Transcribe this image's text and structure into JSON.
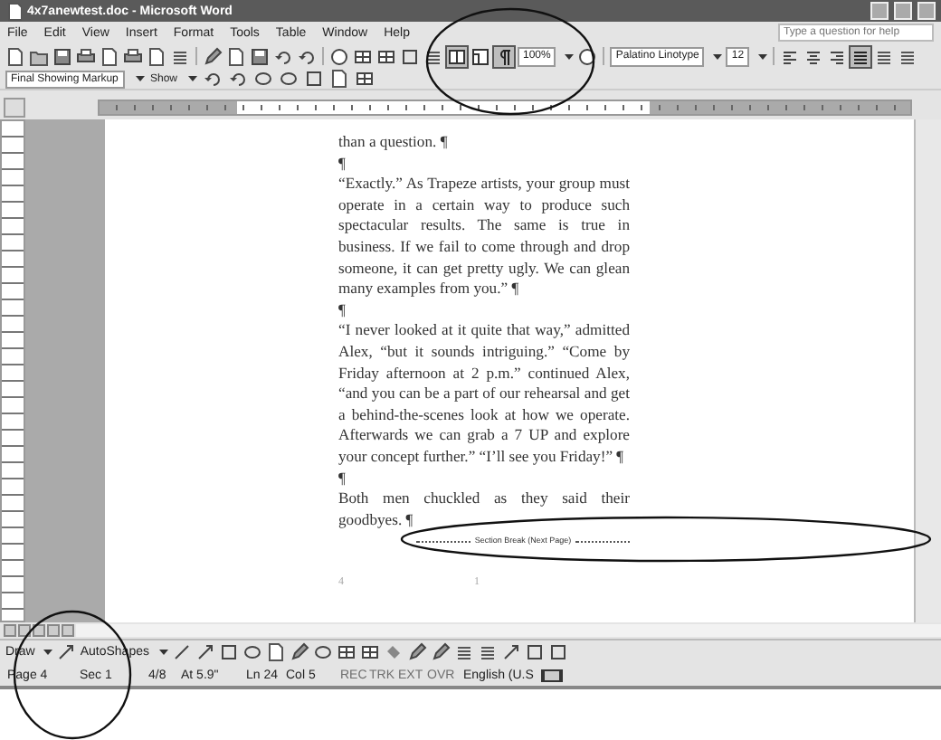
{
  "window": {
    "title": "4x7anewtest.doc - Microsoft Word"
  },
  "menu": [
    "File",
    "Edit",
    "View",
    "Insert",
    "Format",
    "Tools",
    "Table",
    "Window",
    "Help"
  ],
  "help_box": {
    "placeholder": "Type a question for help"
  },
  "standard_toolbar": {
    "toggles": [
      {
        "kind": "reading",
        "selected": true
      },
      {
        "kind": "document-map",
        "selected": false
      },
      {
        "kind": "formatting-marks",
        "selected": true
      }
    ],
    "zoom": "100%"
  },
  "formatting_toolbar": {
    "font": "Palatino Linotype",
    "size": "12",
    "alignments": [
      {
        "kind": "left",
        "selected": false
      },
      {
        "kind": "center",
        "selected": false
      },
      {
        "kind": "right",
        "selected": false
      },
      {
        "kind": "justify",
        "selected": true
      }
    ]
  },
  "reviewing_toolbar": {
    "display": "Final Showing Markup",
    "show": "Show"
  },
  "document": {
    "paragraphs": [
      "than a question. ¶",
      "¶",
      "“Exactly.” As Trapeze artists, your group must operate in a certain way to produce such spectacular results. The same is true in business. If we fail to come through and drop someone, it can get pretty ugly. We can glean many examples from you.” ¶",
      "¶",
      "“I never looked at it quite that way,” admitted Alex, “but it sounds intriguing.” “Come by Friday afternoon at 2 p.m.” continued Alex, “and you can be a part of our rehearsal and get a behind-the-scenes look at how we operate. Afterwards we can grab a 7 UP and explore your concept further.” “I’ll see you Friday!” ¶",
      "¶",
      "Both men chuckled as they said their goodbyes. ¶"
    ],
    "section_break": "Section Break (Next Page)",
    "footer_marks": [
      "4",
      "1"
    ]
  },
  "drawing_toolbar": {
    "draw": "Draw",
    "autoshapes": "AutoShapes"
  },
  "status_bar": {
    "items": [
      "Page 4",
      "Sec 1",
      "4/8",
      "At 5.9\"",
      "Ln 24",
      "Col 5"
    ],
    "modes": [
      {
        "text": "REC",
        "on": false
      },
      {
        "text": "TRK",
        "on": false
      },
      {
        "text": "EXT",
        "on": false
      },
      {
        "text": "OVR",
        "on": false
      }
    ],
    "language": "English (U.S"
  }
}
